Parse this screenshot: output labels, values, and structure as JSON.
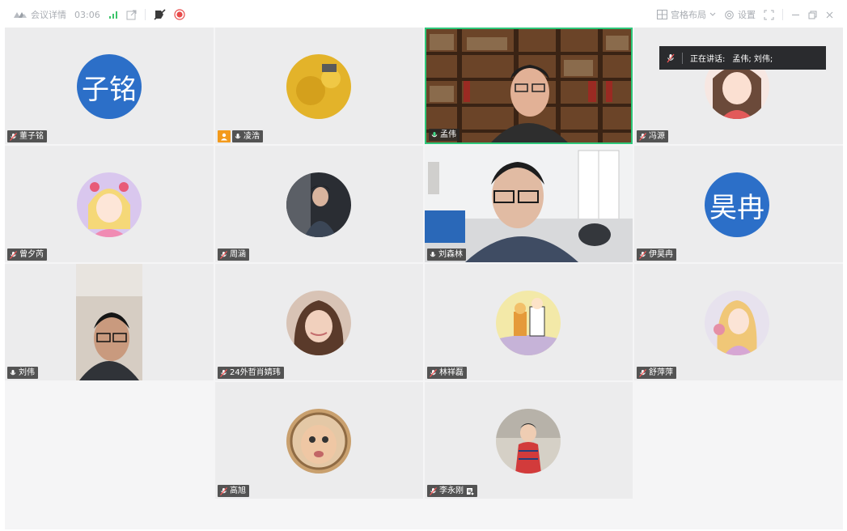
{
  "titlebar": {
    "meeting_details": "会议详情",
    "timer": "03:06",
    "layout_label": "宫格布局",
    "settings_label": "设置"
  },
  "speaking": {
    "prefix": "正在讲话:",
    "names": "孟伟; 刘伟;"
  },
  "participants": [
    {
      "name": "董子铭",
      "avatar_text": "子铭"
    },
    {
      "name": "凌浩"
    },
    {
      "name": "孟伟"
    },
    {
      "name": "冯源"
    },
    {
      "name": "曾夕芮"
    },
    {
      "name": "周涵"
    },
    {
      "name": "刘森林"
    },
    {
      "name": "伊昊冉",
      "avatar_text": "昊冉"
    },
    {
      "name": "刘伟"
    },
    {
      "name": "24外哲肖婧玮"
    },
    {
      "name": "林祥磊"
    },
    {
      "name": "舒萍萍"
    },
    {
      "name": "高旭"
    },
    {
      "name": "李永刚"
    }
  ],
  "colors": {
    "accent_blue": "#2c6fc8",
    "host_orange": "#f39a1c",
    "active_speaker_border": "#2ec77a",
    "record_red": "#e84a4a"
  }
}
